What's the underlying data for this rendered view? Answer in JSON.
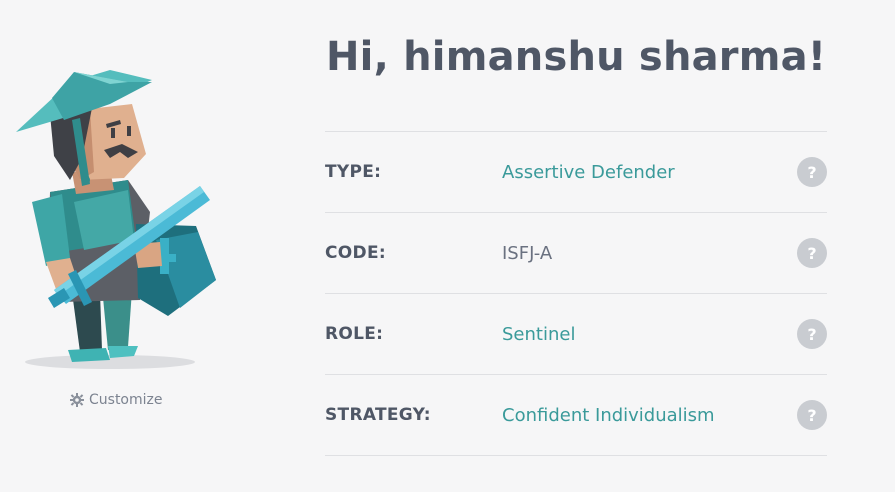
{
  "profile": {
    "greeting": "Hi, himanshu sharma!",
    "customize_label": "Customize"
  },
  "traits": [
    {
      "label": "TYPE:",
      "value": "Assertive Defender",
      "accent": true,
      "help": "?"
    },
    {
      "label": "CODE:",
      "value": "ISFJ-A",
      "accent": false,
      "help": "?"
    },
    {
      "label": "ROLE:",
      "value": "Sentinel",
      "accent": true,
      "help": "?"
    },
    {
      "label": "STRATEGY:",
      "value": "Confident Individualism",
      "accent": true,
      "help": "?"
    }
  ],
  "colors": {
    "accent": "#3a9a9a",
    "heading": "#4f5766",
    "help_badge": "#c9ccd1",
    "background": "#f6f6f7"
  },
  "icons": {
    "customize": "gear-icon",
    "help": "question-mark-icon",
    "avatar": "defender-character-illustration"
  }
}
